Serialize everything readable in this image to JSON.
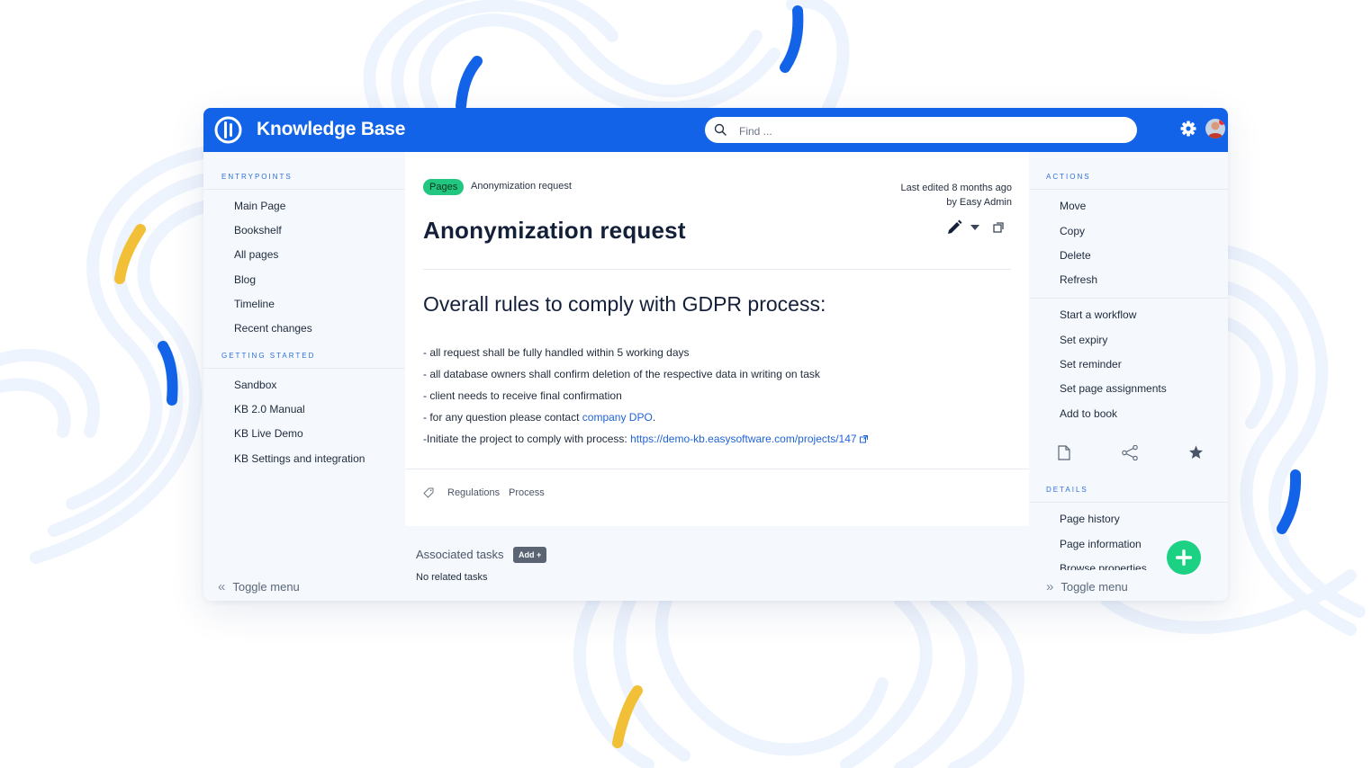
{
  "app": {
    "title": "Knowledge Base"
  },
  "search": {
    "placeholder": "Find ..."
  },
  "colors": {
    "brand": "#1263e8",
    "accent_green": "#22c77f",
    "link": "#1f63d8",
    "fab": "#1dd184"
  },
  "left_sidebar": {
    "entrypoints_heading": "ENTRYPOINTS",
    "entrypoints": [
      "Main Page",
      "Bookshelf",
      "All pages",
      "Blog",
      "Timeline",
      "Recent changes"
    ],
    "getting_started_heading": "GETTING STARTED",
    "getting_started": [
      "Sandbox",
      "KB 2.0 Manual",
      "KB Live Demo",
      "KB Settings and integration"
    ],
    "toggle_label": "Toggle menu"
  },
  "page": {
    "badge": "Pages",
    "breadcrumb": "Anonymization request",
    "edited_prefix": "Last edited",
    "edited_when": "8 months ago",
    "edited_by_prefix": "by",
    "edited_by": "Easy Admin",
    "title": "Anonymization request",
    "heading": "Overall rules to comply with GDPR process:",
    "rules": [
      "- all request shall be fully handled within 5 working days",
      "- all database owners shall confirm deletion of the respective data in writing on task",
      "- client needs to receive final confirmation"
    ],
    "rule_contact_prefix": "- for any question please contact",
    "rule_contact_link": "company DPO",
    "rule_contact_suffix": ".",
    "rule_project_prefix": "-Initiate the project to comply with process:",
    "rule_project_link": "https://demo-kb.easysoftware.com/projects/147",
    "tags": [
      "Regulations",
      "Process"
    ]
  },
  "tasks": {
    "heading": "Associated tasks",
    "add_label": "Add +",
    "empty": "No related tasks"
  },
  "right_sidebar": {
    "actions_heading": "ACTIONS",
    "actions": [
      "Move",
      "Copy",
      "Delete",
      "Refresh"
    ],
    "workflow_actions": [
      "Start a workflow",
      "Set expiry",
      "Set reminder",
      "Set page assignments",
      "Add to book"
    ],
    "icons": [
      "document-icon",
      "share-icon",
      "star-icon"
    ],
    "details_heading": "DETAILS",
    "details": [
      "Page history",
      "Page information",
      "Browse properties"
    ],
    "toggle_label": "Toggle menu"
  }
}
